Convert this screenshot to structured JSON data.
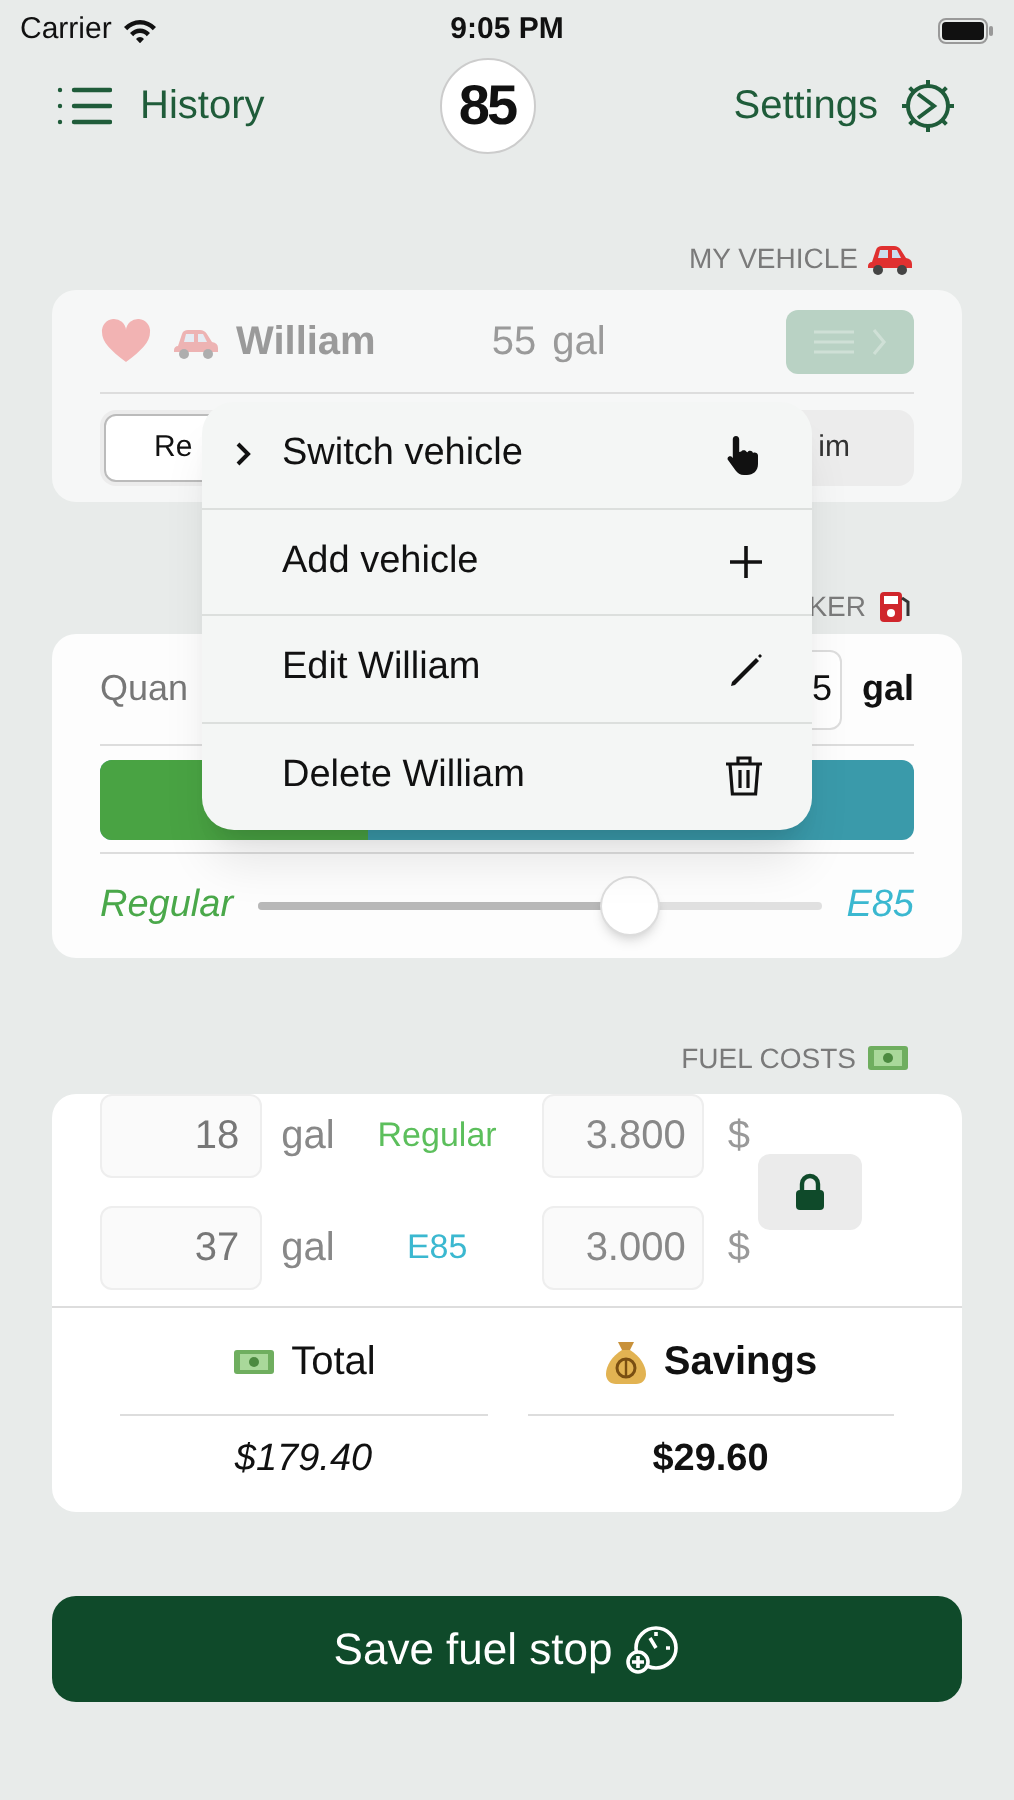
{
  "status_bar": {
    "carrier": "Carrier",
    "time": "9:05 PM"
  },
  "nav": {
    "left": "History",
    "logo": "85",
    "right": "Settings"
  },
  "vehicle_section": {
    "header": "MY VEHICLE",
    "favorite": true,
    "name": "William",
    "capacity": "55",
    "unit": "gal",
    "segments": [
      {
        "label": "Re",
        "selected": true
      },
      {
        "label": "im",
        "selected": false
      }
    ]
  },
  "mixer_section": {
    "header": "KER",
    "quantity_label": "Quan",
    "quantity_value": "5",
    "quantity_unit": "gal",
    "blend": {
      "level": 0.33
    },
    "slider": {
      "left": "Regular",
      "right": "E85",
      "level": 0.66
    }
  },
  "costs": {
    "header": "FUEL COSTS",
    "rows": [
      {
        "amount": "18",
        "unit": "gal",
        "label": "Regular",
        "color": "#5cbf5c",
        "price": "3.800",
        "currency": "$"
      },
      {
        "amount": "37",
        "unit": "gal",
        "label": "E85",
        "color": "#3bb8d0",
        "price": "3.000",
        "currency": "$"
      }
    ],
    "locked": true,
    "total_label": "Total",
    "total": "$179.40",
    "savings_label": "Savings",
    "savings": "$29.60"
  },
  "save_button": "Save fuel stop",
  "menu": {
    "items": [
      {
        "kind": "submenu",
        "label": "Switch vehicle"
      },
      {
        "kind": "add",
        "label": "Add vehicle"
      },
      {
        "kind": "edit",
        "label": "Edit William"
      },
      {
        "kind": "delete",
        "label": "Delete William"
      }
    ]
  }
}
